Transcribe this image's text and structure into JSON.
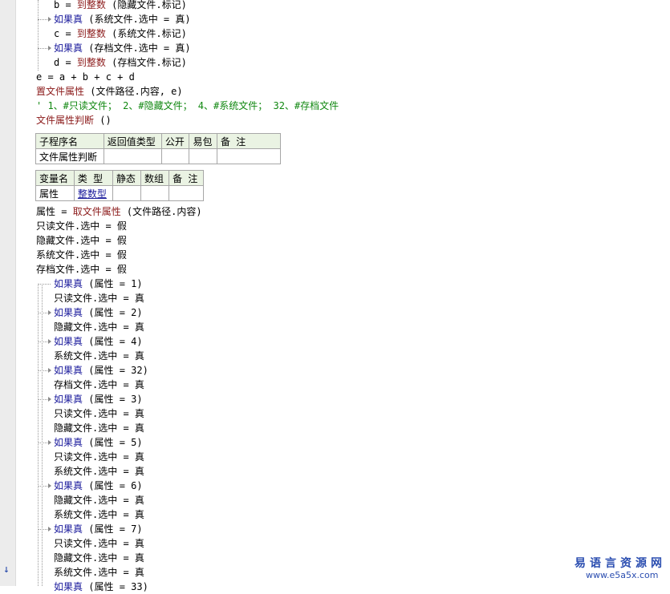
{
  "gutter": {
    "marker": "↓"
  },
  "lines": {
    "l0": "b = ",
    "l0_fn": "到整数",
    "l0_arg": " (隐藏文件.标记)",
    "l1_kw": "如果真",
    "l1_arg": " (系统文件.选中 = 真)",
    "l2": "c = ",
    "l2_fn": "到整数",
    "l2_arg": " (系统文件.标记)",
    "l3_kw": "如果真",
    "l3_arg": " (存档文件.选中 = 真)",
    "l4": "d = ",
    "l4_fn": "到整数",
    "l4_arg": " (存档文件.标记)",
    "l5": "e = a + b + c + d",
    "l6_fn": "置文件属性",
    "l6_arg": " (文件路径.内容, e)",
    "l7_cm": "' 1、#只读文件； 2、#隐藏文件； 4、#系统文件； 32、#存档文件",
    "l8_fn": "文件属性判断",
    "l8_arg": " ()"
  },
  "sub_table": {
    "headers": [
      "子程序名",
      "返回值类型",
      "公开",
      "易包",
      "备 注"
    ],
    "row": [
      "文件属性判断",
      "",
      "",
      "",
      ""
    ]
  },
  "var_table": {
    "headers": [
      "变量名",
      "类 型",
      "静态",
      "数组",
      "备 注"
    ],
    "row": [
      "属性",
      "整数型",
      "",
      "",
      ""
    ]
  },
  "body": {
    "b0": "属性 = ",
    "b0_fn": "取文件属性",
    "b0_arg": " (文件路径.内容)",
    "b1": "只读文件.选中 = 假",
    "b2": "隐藏文件.选中 = 假",
    "b3": "系统文件.选中 = 假",
    "b4": "存档文件.选中 = 假",
    "if_kw": "如果真",
    "c1": " (属性 = 1)",
    "c2": " (属性 = 2)",
    "c4": " (属性 = 4)",
    "c32": " (属性 = 32)",
    "c3": " (属性 = 3)",
    "c5": " (属性 = 5)",
    "c6": " (属性 = 6)",
    "c7": " (属性 = 7)",
    "c_last": " (属性 = 33)",
    "ro_true": "只读文件.选中 = 真",
    "hid_true": "隐藏文件.选中 = 真",
    "sys_true": "系统文件.选中 = 真",
    "arc_true": "存档文件.选中 = 真"
  },
  "watermark": {
    "name": "易语言资源网",
    "url": "www.e5a5x.com"
  }
}
